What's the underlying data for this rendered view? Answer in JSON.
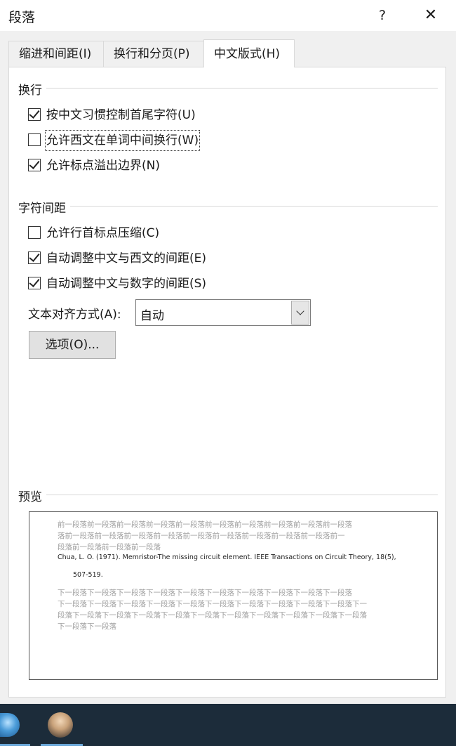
{
  "window": {
    "title": "段落",
    "help_label": "?",
    "close_label": "✕"
  },
  "tabs": [
    {
      "label": "缩进和间距(I)",
      "active": false
    },
    {
      "label": "换行和分页(P)",
      "active": false
    },
    {
      "label": "中文版式(H)",
      "active": true
    }
  ],
  "line_break": {
    "title": "换行",
    "options": [
      {
        "label": "按中文习惯控制首尾字符(U)",
        "checked": true
      },
      {
        "label": "允许西文在单词中间换行(W)",
        "checked": false
      },
      {
        "label": "允许标点溢出边界(N)",
        "checked": true
      }
    ]
  },
  "char_spacing": {
    "title": "字符间距",
    "options": [
      {
        "label": "允许行首标点压缩(C)",
        "checked": false
      },
      {
        "label": "自动调整中文与西文的间距(E)",
        "checked": true
      },
      {
        "label": "自动调整中文与数字的间距(S)",
        "checked": true
      }
    ],
    "align_label": "文本对齐方式(A):",
    "align_value": "自动",
    "options_button": "选项(O)..."
  },
  "preview": {
    "title": "预览",
    "prev_text_1": "前一段落前一段落前一段落前一段落前一段落前一段落前一段落前一段落前一段落前一段落",
    "prev_text_2": "落前一段落前一段落前一段落前一段落前一段落前一段落前一段落前一段落前一段落前一",
    "prev_text_3": "段落前一段落前一段落前一段落",
    "main_line_1": "Chua, L. O. (1971). Memristor-The missing circuit element. IEEE Transactions on Circuit Theory, 18(5),",
    "main_line_2": "507-519.",
    "next_text_1": "下一段落下一段落下一段落下一段落下一段落下一段落下一段落下一段落下一段落下一段落",
    "next_text_2": "下一段落下一段落下一段落下一段落下一段落下一段落下一段落下一段落下一段落下一段落下一",
    "next_text_3": "段落下一段落下一段落下一段落下一段落下一段落下一段落下一段落下一段落下一段落下一段落",
    "next_text_4": "下一段落下一段落"
  },
  "taskbar": {
    "icons": [
      "globe-icon",
      "avatar-icon"
    ]
  }
}
